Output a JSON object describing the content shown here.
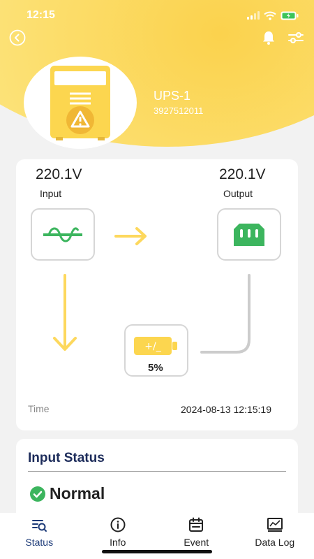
{
  "status_bar": {
    "time": "12:15"
  },
  "device": {
    "name": "UPS-1",
    "id": "3927512011"
  },
  "flow": {
    "input_voltage": "220.1V",
    "input_label": "Input",
    "output_voltage": "220.1V",
    "output_label": "Output",
    "battery_percent": "5%",
    "battery_glyph": "+/_",
    "time_label": "Time",
    "time_value": "2024-08-13 12:15:19"
  },
  "input_status": {
    "title": "Input Status",
    "value": "Normal"
  },
  "tabs": [
    {
      "label": "Status",
      "icon": "status-list-icon",
      "active": true
    },
    {
      "label": "Info",
      "icon": "info-icon",
      "active": false
    },
    {
      "label": "Event",
      "icon": "calendar-icon",
      "active": false
    },
    {
      "label": "Data Log",
      "icon": "chart-log-icon",
      "active": false
    }
  ],
  "colors": {
    "accent_yellow": "#fbd24d",
    "arrow_yellow": "#fdd85d",
    "output_green": "#3cb55e",
    "status_green": "#3cb55e",
    "title_navy": "#1c2b5a"
  }
}
